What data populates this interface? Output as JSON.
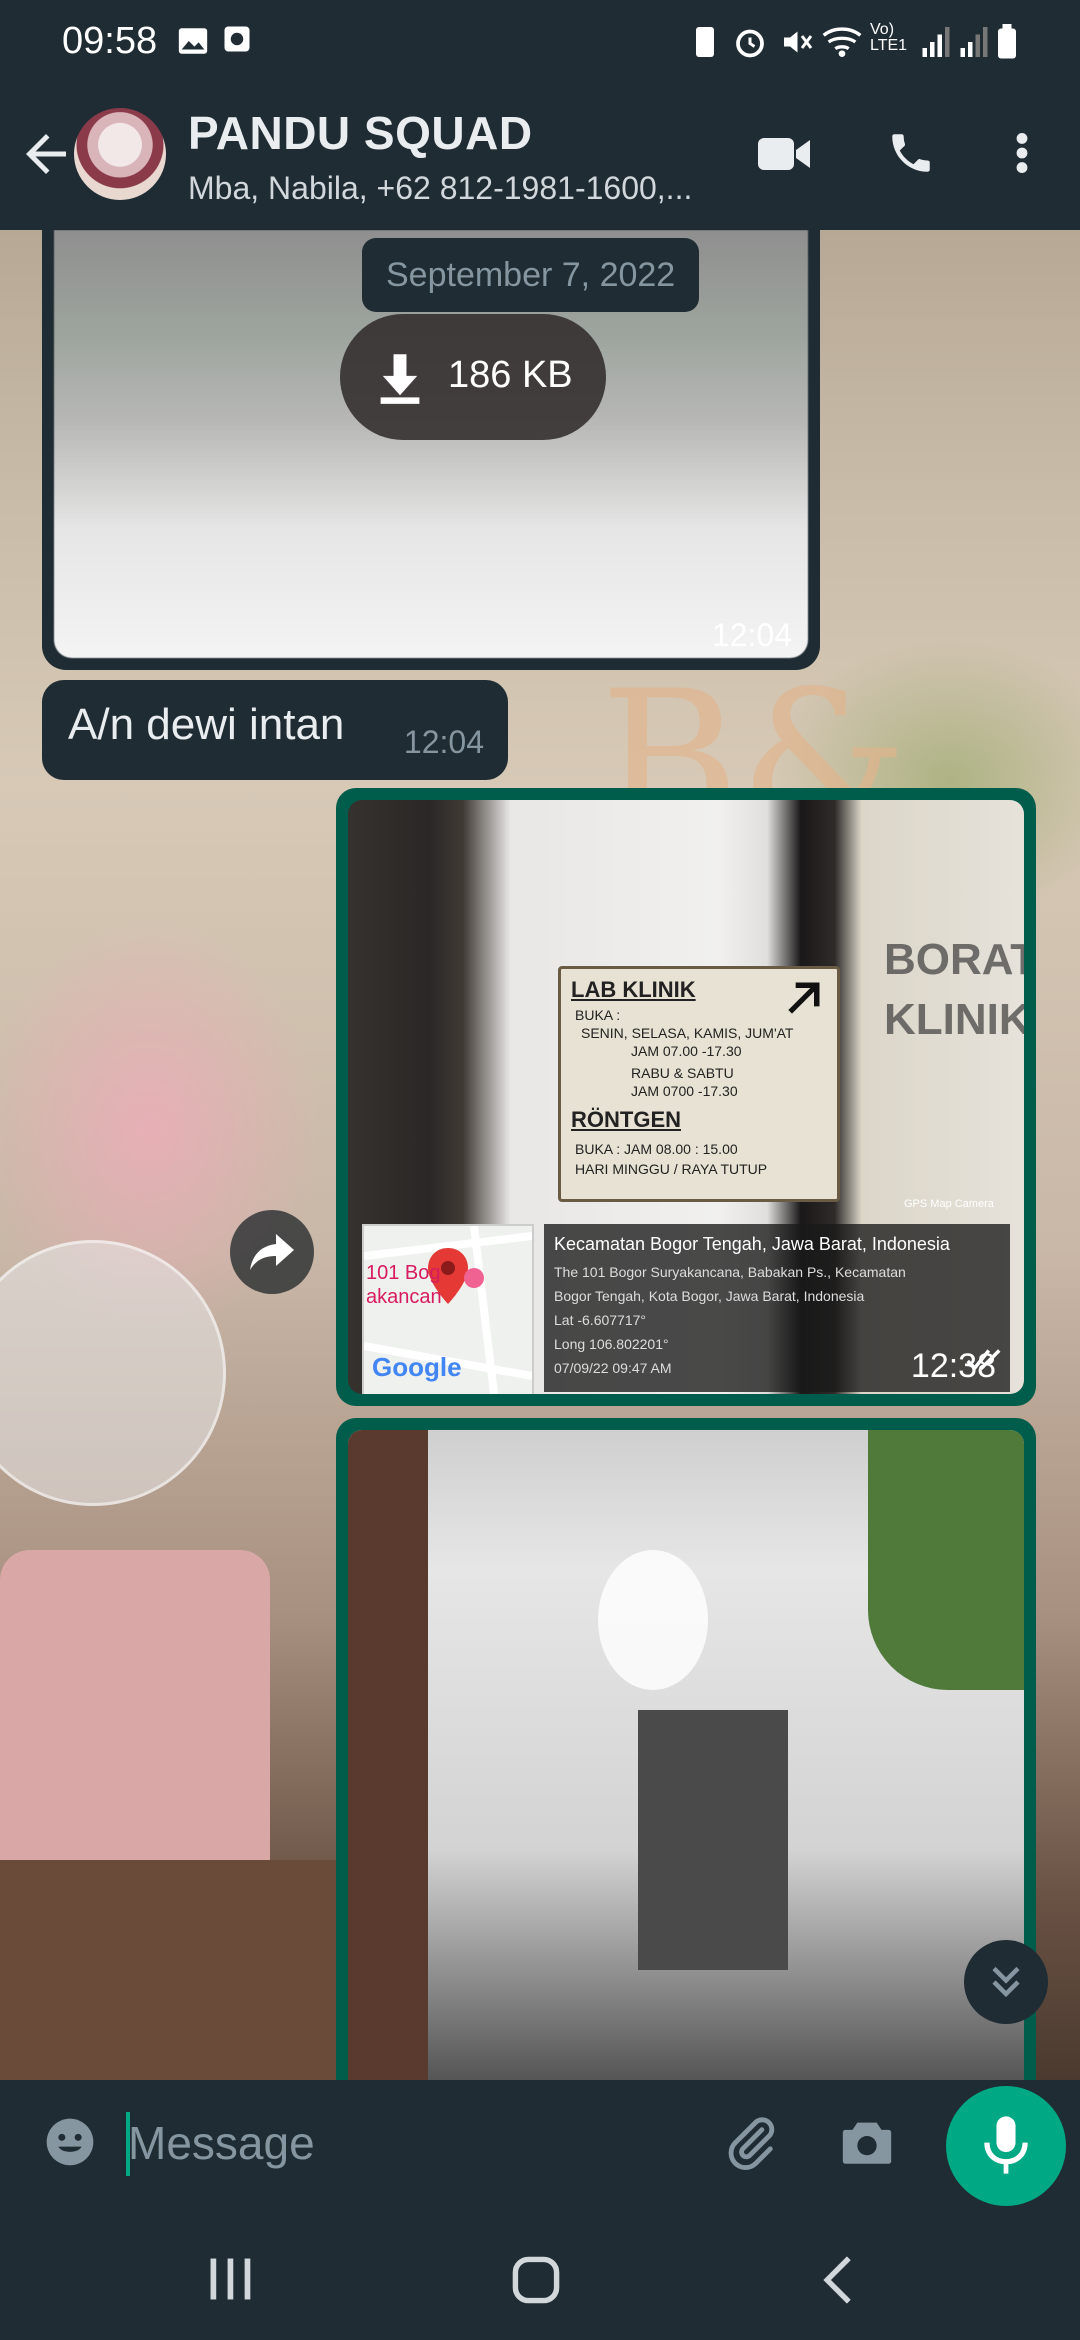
{
  "status_bar": {
    "time": "09:58"
  },
  "header": {
    "title": "PANDU SQUAD",
    "subtitle": "Mba, Nabila, +62 812-1981-1600,..."
  },
  "chat": {
    "date_chip": "September 7, 2022",
    "media1": {
      "download_size": "186 KB",
      "time": "12:04"
    },
    "text_message": {
      "text": "A/n dewi intan",
      "time": "12:04"
    },
    "media2": {
      "sign": {
        "heading1": "LAB KLINIK",
        "buka": "BUKA :",
        "days1": "SENIN, SELASA, KAMIS, JUM'AT",
        "hours1": "JAM 07.00 -17.30",
        "days2": "RABU & SABTU",
        "hours2": "JAM 0700 -17.30",
        "heading2": "RÖNTGEN",
        "buka2": "BUKA : JAM 08.00 : 15.00",
        "closed": "HARI MINGGU / RAYA TUTUP"
      },
      "gps_label": "GPS Map Camera",
      "map_label1": "101 Bog",
      "map_label2": "akancan",
      "google": "Google",
      "geo_title": "Kecamatan Bogor Tengah, Jawa Barat, Indonesia",
      "geo_lines": [
        "The 101 Bogor Suryakancana, Babakan Ps., Kecamatan",
        "Bogor Tengah, Kota Bogor, Jawa Barat, Indonesia",
        "Lat -6.607717°",
        "Long 106.802201°",
        "07/09/22 09:47 AM"
      ],
      "time": "12:38"
    }
  },
  "composer": {
    "placeholder": "Message"
  },
  "colors": {
    "accent": "#00a884",
    "bubble_out": "#005c4b",
    "bar": "#1f2c34"
  },
  "icons": [
    "back-arrow-icon",
    "video-call-icon",
    "phone-icon",
    "more-vert-icon",
    "download-icon",
    "forward-icon",
    "double-check-icon",
    "scroll-down-icon",
    "emoji-icon",
    "attach-icon",
    "camera-icon",
    "mic-icon",
    "recents-icon",
    "home-icon",
    "nav-back-icon"
  ]
}
